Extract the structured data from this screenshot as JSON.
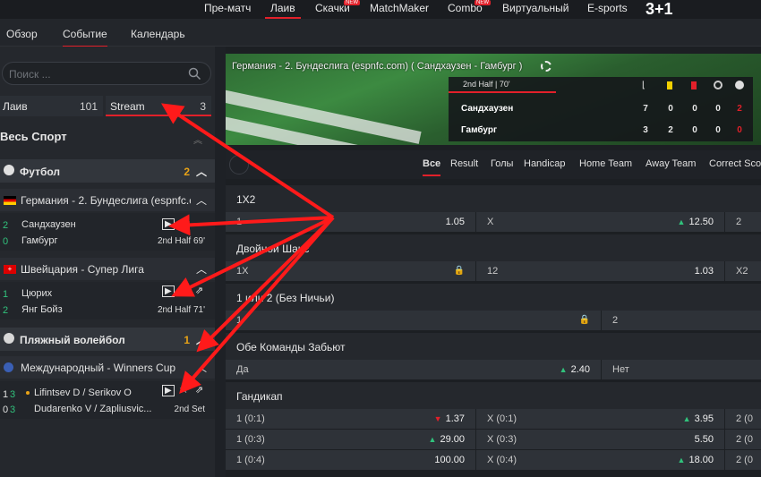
{
  "topnav": {
    "items": [
      "Пре-матч",
      "Лаив",
      "Скачки",
      "MatchMaker",
      "Combo",
      "Виртуальный",
      "E-sports"
    ],
    "badges": {
      "skachki": "NEW",
      "combo": "NEW"
    },
    "brand": "3+1"
  },
  "subnav": {
    "items": [
      "Обзор",
      "Событие",
      "Календарь"
    ]
  },
  "sidebar": {
    "search_placeholder": "Поиск ...",
    "tab_live": {
      "label": "Лаив",
      "count": "101"
    },
    "tab_stream": {
      "label": "Stream",
      "count": "3"
    },
    "all_sport": "Весь Спорт",
    "football": {
      "label": "Футбол",
      "count": "2"
    },
    "league1": "Германия - 2. Бундеслига (espnfc.com)",
    "match1": {
      "team1": "Сандхаузен",
      "team2": "Гамбург",
      "score1": "2",
      "score2": "0",
      "time": "2nd Half 69'"
    },
    "league2": "Швейцария - Супер Лига",
    "match2": {
      "team1": "Цюрих",
      "team2": "Янг Бойз",
      "score1": "1",
      "score2": "2",
      "time": "2nd Half 71'"
    },
    "volleyball": {
      "label": "Пляжный волейбол",
      "count": "1"
    },
    "league3": "Международный - Winners Cup",
    "match3": {
      "team1": "Lifintsev D / Serikov O",
      "team2": "Dudarenko V / Zapliusvic...",
      "score1a": "1",
      "score1b": "3",
      "score2a": "0",
      "score2b": "3",
      "time": "2nd Set"
    }
  },
  "banner": {
    "title": "Германия - 2. Бундеслига (espnfc.com) ( Сандхаузен - Гамбург )",
    "half": "2nd Half | 70'",
    "team1": {
      "name": "Сандхаузен",
      "stats": [
        "7",
        "0",
        "0",
        "0",
        "2"
      ]
    },
    "team2": {
      "name": "Гамбург",
      "stats": [
        "3",
        "2",
        "0",
        "0",
        "0"
      ]
    }
  },
  "market_tabs": [
    "Все",
    "Result",
    "Голы",
    "Handicap",
    "Home Team",
    "Away Team",
    "Correct Sco"
  ],
  "markets": {
    "m1x2": {
      "title": "1X2",
      "c1l": "1",
      "c1v": "1.05",
      "c2l": "X",
      "c2v": "12.50",
      "c3l": "2"
    },
    "double": {
      "title": "Двойной Шанс",
      "c1l": "1X",
      "c2l": "12",
      "c2v": "1.03",
      "c3l": "X2"
    },
    "noDraw": {
      "title": "1 или 2 (Без Ничьи)",
      "c1l": "1",
      "c2l": "2"
    },
    "btts": {
      "title": "Обе Команды Забьют",
      "c1l": "Да",
      "c1v": "2.40",
      "c2l": "Нет"
    },
    "handicap": {
      "title": "Гандикап",
      "rows": [
        {
          "a": "1 (0:1)",
          "av": "1.37",
          "b": "X (0:1)",
          "bv": "3.95",
          "c": "2 (0"
        },
        {
          "a": "1 (0:3)",
          "av": "29.00",
          "b": "X (0:3)",
          "bv": "5.50",
          "c": "2 (0"
        },
        {
          "a": "1 (0:4)",
          "av": "100.00",
          "b": "X (0:4)",
          "bv": "18.00",
          "c": "2 (0"
        }
      ]
    }
  },
  "colors": {
    "accent": "#e2202a",
    "up": "#31c27c",
    "highlight": "#e8a317"
  }
}
